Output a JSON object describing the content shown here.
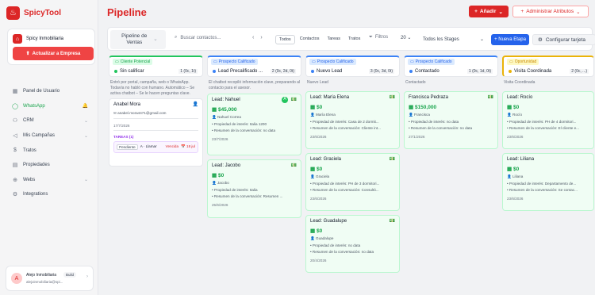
{
  "app": {
    "name": "SpicyTool"
  },
  "sidebar": {
    "company": "Spicy Inmobiliaria",
    "update_button": "Actualizar a Empresa",
    "items": [
      {
        "label": "Panel de Usuario",
        "icon": "grid-icon",
        "active": false,
        "suffix": ""
      },
      {
        "label": "WhatsApp",
        "icon": "whatsapp-icon",
        "active": true,
        "suffix": "🔔"
      },
      {
        "label": "CRM",
        "icon": "users-icon",
        "active": false,
        "suffix": "⌄"
      },
      {
        "label": "Mis Campañas",
        "icon": "megaphone-icon",
        "active": false,
        "suffix": "⌄"
      },
      {
        "label": "Tratos",
        "icon": "dollar-icon",
        "active": false,
        "suffix": ""
      },
      {
        "label": "Propiedades",
        "icon": "building-icon",
        "active": false,
        "suffix": ""
      },
      {
        "label": "Webs",
        "icon": "globe-icon",
        "active": false,
        "suffix": "⌄"
      },
      {
        "label": "Integrations",
        "icon": "plug-icon",
        "active": false,
        "suffix": ""
      }
    ],
    "user": {
      "name": "Alejo Inmobiliaria",
      "badge": "Build",
      "email": "alejoinmobiliaria@spi..."
    }
  },
  "header": {
    "title": "Pipeline",
    "add_button": "Añadir",
    "attributes_button": "Administrar Atributos"
  },
  "toolbar": {
    "pipeline_select": "Pipeline de Ventas",
    "search_placeholder": "Buscar contactos...",
    "tabs": [
      "Todos",
      "Contactos",
      "Tareas",
      "Tratos"
    ],
    "filters": "Filtros",
    "count": "20",
    "stage_select": "Todos los Stages",
    "new_stage": "+ Nueva Etapa",
    "config": "Configurar tarjeta"
  },
  "columns": [
    {
      "tag": "Cliente Potencial",
      "tag_color": "#16a34a",
      "tag_bg": "#dcfce7",
      "top": "#22c55e",
      "name": "Sin calificar",
      "dot": "#22c55e",
      "counts": "1 (0c, 1t)",
      "desc": "Entró por portal, campaña, web o WhatsApp. Todavía no habló con humano. Automático – Se activa chatbot – Se le hacen preguntas clave."
    },
    {
      "tag": "Prospecto Calificado",
      "tag_color": "#2563eb",
      "tag_bg": "#dbeafe",
      "top": "#3b82f6",
      "name": "Lead Precalificado ...",
      "dot": "#3b82f6",
      "counts": "2 (0c, 2d, 0t)",
      "desc": "El chatbot recopiló información clave, preparando al contacto para el asesor."
    },
    {
      "tag": "Prospecto Calificado",
      "tag_color": "#2563eb",
      "tag_bg": "#dbeafe",
      "top": "#3b82f6",
      "name": "Nuevo Lead",
      "dot": "#3b82f6",
      "counts": "3 (0c, 3d, 0t)",
      "desc": "Nuevo Lead"
    },
    {
      "tag": "Prospecto Calificado",
      "tag_color": "#2563eb",
      "tag_bg": "#dbeafe",
      "top": "#3b82f6",
      "name": "Contactado",
      "dot": "#3b82f6",
      "counts": "1 (0c, 1d, 0t)",
      "desc": "Contactado"
    },
    {
      "tag": "Oportunidad",
      "tag_color": "#ca8a04",
      "tag_bg": "#fef9c3",
      "top": "#eab308",
      "name": "Visita Coordinada",
      "dot": "#eab308",
      "counts": "2 (0c, ...)",
      "desc": "Visita Coordinada"
    }
  ],
  "cards": {
    "c1": {
      "title": "Anabel Mora",
      "email": "anabel.mora4471@gmail.com",
      "date": "17/7/2026",
      "tareas": "TAREAS (1)",
      "task_status": "Pendiente",
      "task_name": "A · Llamar",
      "task_flag": "Vencida",
      "task_date": "18 jul"
    },
    "c2a": {
      "title": "Lead: Nahuel",
      "amount": "$45,000",
      "contact": "Nahuel Correa",
      "interest": "Propiedad de interés: Italia 1200",
      "summary": "Resumen de la conversación: no data",
      "date": "23/7/2026"
    },
    "c2b": {
      "title": "Lead: Jacobo",
      "amount": "$0",
      "contact": "Jacobo",
      "interest": "Propiedad de interés: Italia",
      "summary": "Resumen de la conversación: Resumen ...",
      "date": "25/6/2026"
    },
    "c3a": {
      "title": "Lead: María Elena",
      "amount": "$0",
      "contact": "María Elena",
      "interest": "Propiedad de interés: Casa de 2 dormit...",
      "summary": "Resumen de la conversación: Cliente int...",
      "date": "23/6/2026"
    },
    "c3b": {
      "title": "Lead: Graciela",
      "amount": "$0",
      "contact": "Graciela",
      "interest": "Propiedad de interés: PH de 3 dormitori...",
      "summary": "Resumen de la conversación: Consultó...",
      "date": "23/6/2026"
    },
    "c3c": {
      "title": "Lead: Guadalupe",
      "amount": "$0",
      "contact": "Guadalupe",
      "interest": "Propiedad de interés: no data",
      "summary": "Resumen de la conversación: no data",
      "date": "20/4/2026"
    },
    "c4a": {
      "title": "Francisca Pedraza",
      "amount": "$150,000",
      "contact": "Francisca",
      "interest": "Propiedad de interés: no data",
      "summary": "Resumen de la conversación: no data",
      "date": "27/1/2026"
    },
    "c5a": {
      "title": "Lead: Rocío",
      "amount": "$0",
      "contact": "Rocío",
      "interest": "Propiedad de interés: PH de 4 dormitori...",
      "summary": "Resumen de la conversación: El cliente e...",
      "date": "23/6/2026"
    },
    "c5b": {
      "title": "Lead: Liliana",
      "amount": "$0",
      "contact": "Liliana",
      "interest": "Propiedad de interés: Departamento de...",
      "summary": "Resumen de la conversación: Se contac...",
      "date": "23/6/2026"
    }
  }
}
